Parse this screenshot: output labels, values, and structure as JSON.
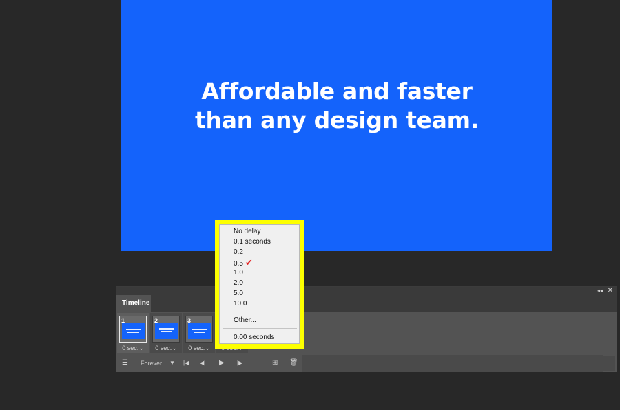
{
  "canvas": {
    "line1": "Affordable and faster",
    "line2": "than any design team.",
    "bg_color": "#1463fb"
  },
  "panel": {
    "tab_label": "Timeline",
    "collapse_icon": "collapse-icon",
    "close_icon": "close-icon",
    "menu_icon": "panel-menu-icon"
  },
  "frames": [
    {
      "number": "1",
      "delay": "0 sec."
    },
    {
      "number": "2",
      "delay": "0 sec."
    },
    {
      "number": "3",
      "delay": "0 sec."
    },
    {
      "number": "",
      "delay": "0 sec."
    }
  ],
  "controls": {
    "loop_value": "Forever",
    "icons": [
      "convert-to-video-timeline-icon",
      "select-first-frame-icon",
      "select-previous-frame-icon",
      "play-icon",
      "select-next-frame-icon",
      "tween-icon",
      "duplicate-frame-icon",
      "delete-frame-icon"
    ]
  },
  "delay_menu": {
    "items": [
      "No delay",
      "0.1 seconds",
      "0.2",
      "0.5",
      "1.0",
      "2.0",
      "5.0",
      "10.0"
    ],
    "selected": "0.5",
    "other": "Other...",
    "current": "0.00 seconds",
    "highlight_color": "#fdff00",
    "check_color": "#e31f1f"
  }
}
